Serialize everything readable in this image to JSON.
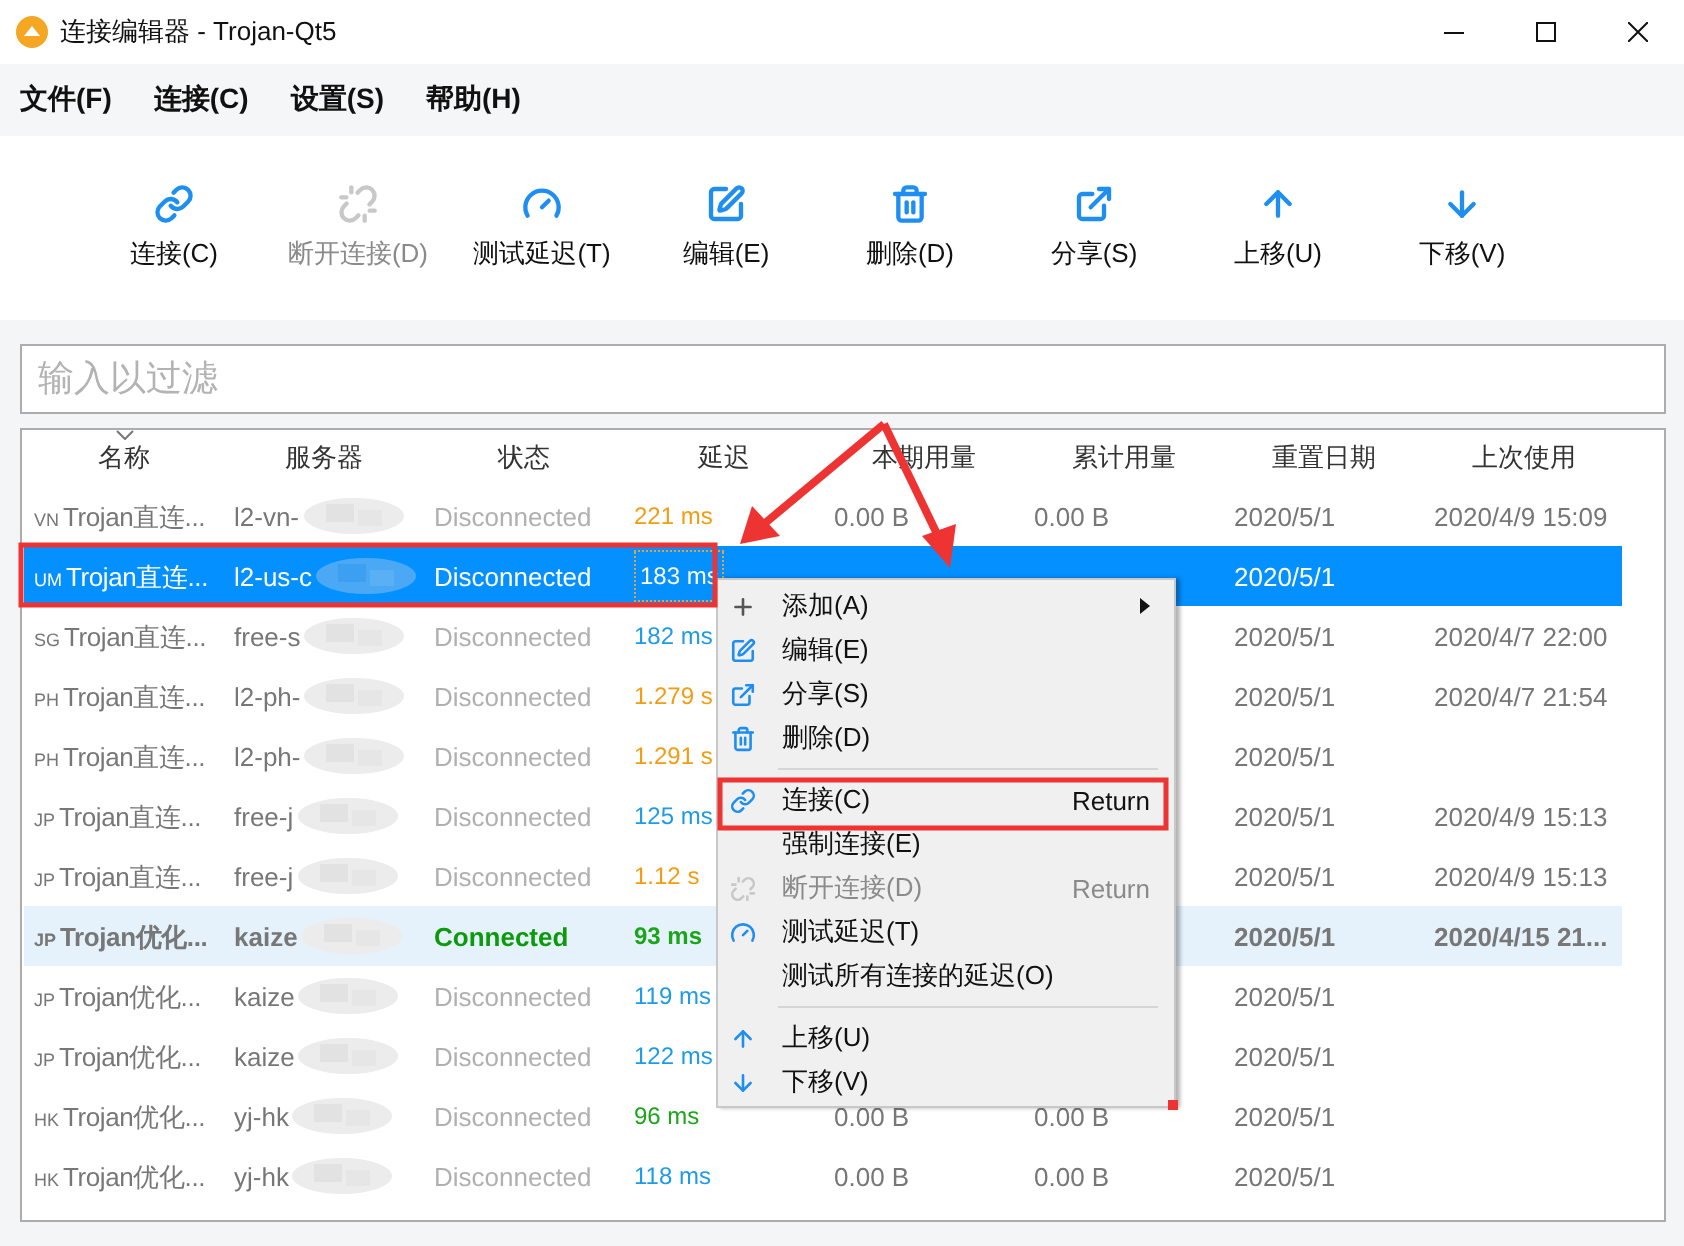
{
  "window": {
    "title": "连接编辑器 - Trojan-Qt5"
  },
  "menu_bar": [
    "文件(F)",
    "连接(C)",
    "设置(S)",
    "帮助(H)"
  ],
  "toolbar": [
    {
      "label": "连接(C)",
      "disabled": false
    },
    {
      "label": "断开连接(D)",
      "disabled": true
    },
    {
      "label": "测试延迟(T)",
      "disabled": false
    },
    {
      "label": "编辑(E)",
      "disabled": false
    },
    {
      "label": "删除(D)",
      "disabled": false
    },
    {
      "label": "分享(S)",
      "disabled": false
    },
    {
      "label": "上移(U)",
      "disabled": false
    },
    {
      "label": "下移(V)",
      "disabled": false
    }
  ],
  "filter": {
    "placeholder": "输入以过滤"
  },
  "table": {
    "columns": [
      "名称",
      "服务器",
      "状态",
      "延迟",
      "本期用量",
      "累计用量",
      "重置日期",
      "上次使用"
    ],
    "rows": [
      {
        "region": "VN",
        "name": "Trojan直连...",
        "server": "l2-vn-",
        "status": "Disconnected",
        "connected": false,
        "selected": false,
        "delay": {
          "text": "221 ms",
          "color": "#f39c12"
        },
        "period": "0.00 B",
        "total": "0.00 B",
        "reset": "2020/5/1",
        "last_used": "2020/4/9 15:09"
      },
      {
        "region": "UM",
        "name": "Trojan直连...",
        "server": "l2-us-c",
        "status": "Disconnected",
        "connected": false,
        "selected": true,
        "delay": {
          "text": "183 ms",
          "color": "#e8a13a"
        },
        "reset": "2020/5/1"
      },
      {
        "region": "SG",
        "name": "Trojan直连...",
        "server": "free-s",
        "status": "Disconnected",
        "connected": false,
        "selected": false,
        "delay": {
          "text": "182 ms",
          "color": "#1e9be8"
        },
        "reset": "2020/5/1",
        "last_used": "2020/4/7 22:00"
      },
      {
        "region": "PH",
        "name": "Trojan直连...",
        "server": "l2-ph-",
        "status": "Disconnected",
        "connected": false,
        "selected": false,
        "delay": {
          "text": "1.279 s",
          "color": "#f39c12"
        },
        "reset": "2020/5/1",
        "last_used": "2020/4/7 21:54"
      },
      {
        "region": "PH",
        "name": "Trojan直连...",
        "server": "l2-ph-",
        "status": "Disconnected",
        "connected": false,
        "selected": false,
        "delay": {
          "text": "1.291 s",
          "color": "#f39c12"
        },
        "reset": "2020/5/1"
      },
      {
        "region": "JP",
        "name": "Trojan直连...",
        "server": "free-j",
        "status": "Disconnected",
        "connected": false,
        "selected": false,
        "delay": {
          "text": "125 ms",
          "color": "#1e9be8"
        },
        "reset": "2020/5/1",
        "last_used": "2020/4/9 15:13"
      },
      {
        "region": "JP",
        "name": "Trojan直连...",
        "server": "free-j",
        "status": "Disconnected",
        "connected": false,
        "selected": false,
        "delay": {
          "text": "1.12 s",
          "color": "#f39c12"
        },
        "reset": "2020/5/1",
        "last_used": "2020/4/9 15:13"
      },
      {
        "region": "JP",
        "name": "Trojan优化...",
        "server": "kaize",
        "status": "Connected",
        "connected": true,
        "selected": false,
        "delay": {
          "text": "93 ms",
          "color": "#1aa51a"
        },
        "reset": "2020/5/1",
        "last_used": "2020/4/15 21..."
      },
      {
        "region": "JP",
        "name": "Trojan优化...",
        "server": "kaize",
        "status": "Disconnected",
        "connected": false,
        "selected": false,
        "delay": {
          "text": "119 ms",
          "color": "#1e9be8"
        },
        "reset": "2020/5/1"
      },
      {
        "region": "JP",
        "name": "Trojan优化...",
        "server": "kaize",
        "status": "Disconnected",
        "connected": false,
        "selected": false,
        "delay": {
          "text": "122 ms",
          "color": "#1e9be8"
        },
        "reset": "2020/5/1"
      },
      {
        "region": "HK",
        "name": "Trojan优化...",
        "server": "yj-hk",
        "status": "Disconnected",
        "connected": false,
        "selected": false,
        "delay": {
          "text": "96 ms",
          "color": "#1aa51a"
        },
        "period": "0.00 B",
        "total": "0.00 B",
        "reset": "2020/5/1"
      },
      {
        "region": "HK",
        "name": "Trojan优化...",
        "server": "yj-hk",
        "status": "Disconnected",
        "connected": false,
        "selected": false,
        "delay": {
          "text": "118 ms",
          "color": "#1e9be8"
        },
        "period": "0.00 B",
        "total": "0.00 B",
        "reset": "2020/5/1"
      }
    ]
  },
  "context_menu": {
    "items": [
      {
        "kind": "item",
        "label": "添加(A)",
        "submenu": true,
        "disabled": false
      },
      {
        "kind": "item",
        "label": "编辑(E)",
        "disabled": false
      },
      {
        "kind": "item",
        "label": "分享(S)",
        "disabled": false
      },
      {
        "kind": "item",
        "label": "删除(D)",
        "disabled": false
      },
      {
        "kind": "separator"
      },
      {
        "kind": "item",
        "label": "连接(C)",
        "shortcut": "Return",
        "disabled": false
      },
      {
        "kind": "item",
        "label": "强制连接(E)",
        "disabled": false
      },
      {
        "kind": "item",
        "label": "断开连接(D)",
        "shortcut": "Return",
        "disabled": true
      },
      {
        "kind": "item",
        "label": "测试延迟(T)",
        "disabled": false
      },
      {
        "kind": "item",
        "label": "测试所有连接的延迟(O)",
        "disabled": false
      },
      {
        "kind": "separator"
      },
      {
        "kind": "item",
        "label": "上移(U)",
        "disabled": false
      },
      {
        "kind": "item",
        "label": "下移(V)",
        "disabled": false
      }
    ]
  }
}
